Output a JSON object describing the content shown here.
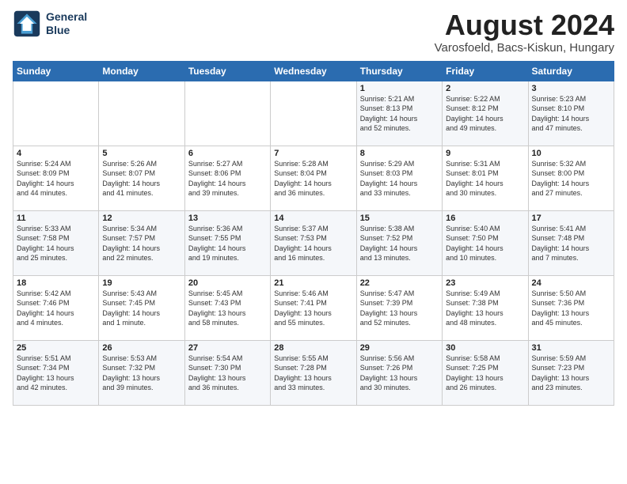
{
  "logo": {
    "line1": "General",
    "line2": "Blue"
  },
  "title": "August 2024",
  "subtitle": "Varosfoeld, Bacs-Kiskun, Hungary",
  "weekdays": [
    "Sunday",
    "Monday",
    "Tuesday",
    "Wednesday",
    "Thursday",
    "Friday",
    "Saturday"
  ],
  "weeks": [
    [
      {
        "day": "",
        "info": ""
      },
      {
        "day": "",
        "info": ""
      },
      {
        "day": "",
        "info": ""
      },
      {
        "day": "",
        "info": ""
      },
      {
        "day": "1",
        "info": "Sunrise: 5:21 AM\nSunset: 8:13 PM\nDaylight: 14 hours\nand 52 minutes."
      },
      {
        "day": "2",
        "info": "Sunrise: 5:22 AM\nSunset: 8:12 PM\nDaylight: 14 hours\nand 49 minutes."
      },
      {
        "day": "3",
        "info": "Sunrise: 5:23 AM\nSunset: 8:10 PM\nDaylight: 14 hours\nand 47 minutes."
      }
    ],
    [
      {
        "day": "4",
        "info": "Sunrise: 5:24 AM\nSunset: 8:09 PM\nDaylight: 14 hours\nand 44 minutes."
      },
      {
        "day": "5",
        "info": "Sunrise: 5:26 AM\nSunset: 8:07 PM\nDaylight: 14 hours\nand 41 minutes."
      },
      {
        "day": "6",
        "info": "Sunrise: 5:27 AM\nSunset: 8:06 PM\nDaylight: 14 hours\nand 39 minutes."
      },
      {
        "day": "7",
        "info": "Sunrise: 5:28 AM\nSunset: 8:04 PM\nDaylight: 14 hours\nand 36 minutes."
      },
      {
        "day": "8",
        "info": "Sunrise: 5:29 AM\nSunset: 8:03 PM\nDaylight: 14 hours\nand 33 minutes."
      },
      {
        "day": "9",
        "info": "Sunrise: 5:31 AM\nSunset: 8:01 PM\nDaylight: 14 hours\nand 30 minutes."
      },
      {
        "day": "10",
        "info": "Sunrise: 5:32 AM\nSunset: 8:00 PM\nDaylight: 14 hours\nand 27 minutes."
      }
    ],
    [
      {
        "day": "11",
        "info": "Sunrise: 5:33 AM\nSunset: 7:58 PM\nDaylight: 14 hours\nand 25 minutes."
      },
      {
        "day": "12",
        "info": "Sunrise: 5:34 AM\nSunset: 7:57 PM\nDaylight: 14 hours\nand 22 minutes."
      },
      {
        "day": "13",
        "info": "Sunrise: 5:36 AM\nSunset: 7:55 PM\nDaylight: 14 hours\nand 19 minutes."
      },
      {
        "day": "14",
        "info": "Sunrise: 5:37 AM\nSunset: 7:53 PM\nDaylight: 14 hours\nand 16 minutes."
      },
      {
        "day": "15",
        "info": "Sunrise: 5:38 AM\nSunset: 7:52 PM\nDaylight: 14 hours\nand 13 minutes."
      },
      {
        "day": "16",
        "info": "Sunrise: 5:40 AM\nSunset: 7:50 PM\nDaylight: 14 hours\nand 10 minutes."
      },
      {
        "day": "17",
        "info": "Sunrise: 5:41 AM\nSunset: 7:48 PM\nDaylight: 14 hours\nand 7 minutes."
      }
    ],
    [
      {
        "day": "18",
        "info": "Sunrise: 5:42 AM\nSunset: 7:46 PM\nDaylight: 14 hours\nand 4 minutes."
      },
      {
        "day": "19",
        "info": "Sunrise: 5:43 AM\nSunset: 7:45 PM\nDaylight: 14 hours\nand 1 minute."
      },
      {
        "day": "20",
        "info": "Sunrise: 5:45 AM\nSunset: 7:43 PM\nDaylight: 13 hours\nand 58 minutes."
      },
      {
        "day": "21",
        "info": "Sunrise: 5:46 AM\nSunset: 7:41 PM\nDaylight: 13 hours\nand 55 minutes."
      },
      {
        "day": "22",
        "info": "Sunrise: 5:47 AM\nSunset: 7:39 PM\nDaylight: 13 hours\nand 52 minutes."
      },
      {
        "day": "23",
        "info": "Sunrise: 5:49 AM\nSunset: 7:38 PM\nDaylight: 13 hours\nand 48 minutes."
      },
      {
        "day": "24",
        "info": "Sunrise: 5:50 AM\nSunset: 7:36 PM\nDaylight: 13 hours\nand 45 minutes."
      }
    ],
    [
      {
        "day": "25",
        "info": "Sunrise: 5:51 AM\nSunset: 7:34 PM\nDaylight: 13 hours\nand 42 minutes."
      },
      {
        "day": "26",
        "info": "Sunrise: 5:53 AM\nSunset: 7:32 PM\nDaylight: 13 hours\nand 39 minutes."
      },
      {
        "day": "27",
        "info": "Sunrise: 5:54 AM\nSunset: 7:30 PM\nDaylight: 13 hours\nand 36 minutes."
      },
      {
        "day": "28",
        "info": "Sunrise: 5:55 AM\nSunset: 7:28 PM\nDaylight: 13 hours\nand 33 minutes."
      },
      {
        "day": "29",
        "info": "Sunrise: 5:56 AM\nSunset: 7:26 PM\nDaylight: 13 hours\nand 30 minutes."
      },
      {
        "day": "30",
        "info": "Sunrise: 5:58 AM\nSunset: 7:25 PM\nDaylight: 13 hours\nand 26 minutes."
      },
      {
        "day": "31",
        "info": "Sunrise: 5:59 AM\nSunset: 7:23 PM\nDaylight: 13 hours\nand 23 minutes."
      }
    ]
  ]
}
